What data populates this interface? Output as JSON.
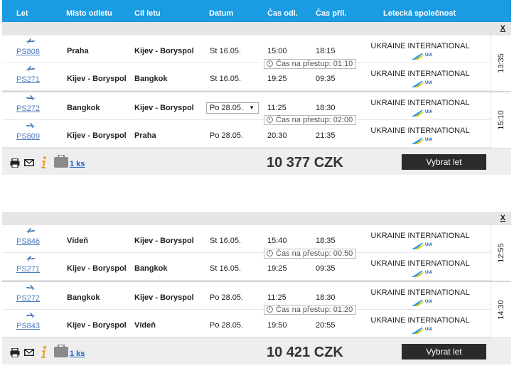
{
  "header": {
    "flight": "Let",
    "origin": "Místo odletu",
    "destination": "Cíl letu",
    "date": "Datum",
    "departure": "Čas odl.",
    "arrival": "Čas příl.",
    "airline": "Letecká společnost"
  },
  "close_label": "X",
  "airline_name": "UKRAINE INTERNATIONAL",
  "airline_logo_text": "UIA",
  "select_button_label": "Vybrat let",
  "offers": [
    {
      "flights": [
        {
          "code": "PS808",
          "from": "Praha",
          "to": "Kijev - Boryspol",
          "date": "St 16.05.",
          "dep": "15:00",
          "arr": "18:15"
        },
        {
          "code": "PS271",
          "from": "Kijev - Boryspol",
          "to": "Bangkok",
          "date": "St 16.05.",
          "dep": "19:25",
          "arr": "09:35"
        },
        {
          "code": "PS272",
          "from": "Bangkok",
          "to": "Kijev - Boryspol",
          "date": "Po 28.05.",
          "dep": "11:25",
          "arr": "18:30"
        },
        {
          "code": "PS809",
          "from": "Kijev - Boryspol",
          "to": "Praha",
          "date": "Po 28.05.",
          "dep": "20:30",
          "arr": "21:35"
        }
      ],
      "transfers": [
        "Čas na přestup: 01:10",
        "Čas na přestup: 02:00"
      ],
      "durations": [
        "13:35",
        "15:10"
      ],
      "baggage": "1 ks",
      "price": "10 377 CZK"
    },
    {
      "flights": [
        {
          "code": "PS846",
          "from": "Vídeň",
          "to": "Kijev - Boryspol",
          "date": "St 16.05.",
          "dep": "15:40",
          "arr": "18:35"
        },
        {
          "code": "PS271",
          "from": "Kijev - Boryspol",
          "to": "Bangkok",
          "date": "St 16.05.",
          "dep": "19:25",
          "arr": "09:35"
        },
        {
          "code": "PS272",
          "from": "Bangkok",
          "to": "Kijev - Boryspol",
          "date": "Po 28.05.",
          "dep": "11:25",
          "arr": "18:30"
        },
        {
          "code": "PS843",
          "from": "Kijev - Boryspol",
          "to": "Vídeň",
          "date": "Po 28.05.",
          "dep": "19:50",
          "arr": "20:55"
        }
      ],
      "transfers": [
        "Čas na přestup: 00:50",
        "Čas na přestup: 01:20"
      ],
      "durations": [
        "12:55",
        "14:30"
      ],
      "baggage": "1 ks",
      "price": "10 421 CZK"
    }
  ],
  "colors": {
    "header": "#1a9be2",
    "button": "#2b2b2b",
    "info": "#f0a020",
    "link": "#4a7bbf"
  }
}
